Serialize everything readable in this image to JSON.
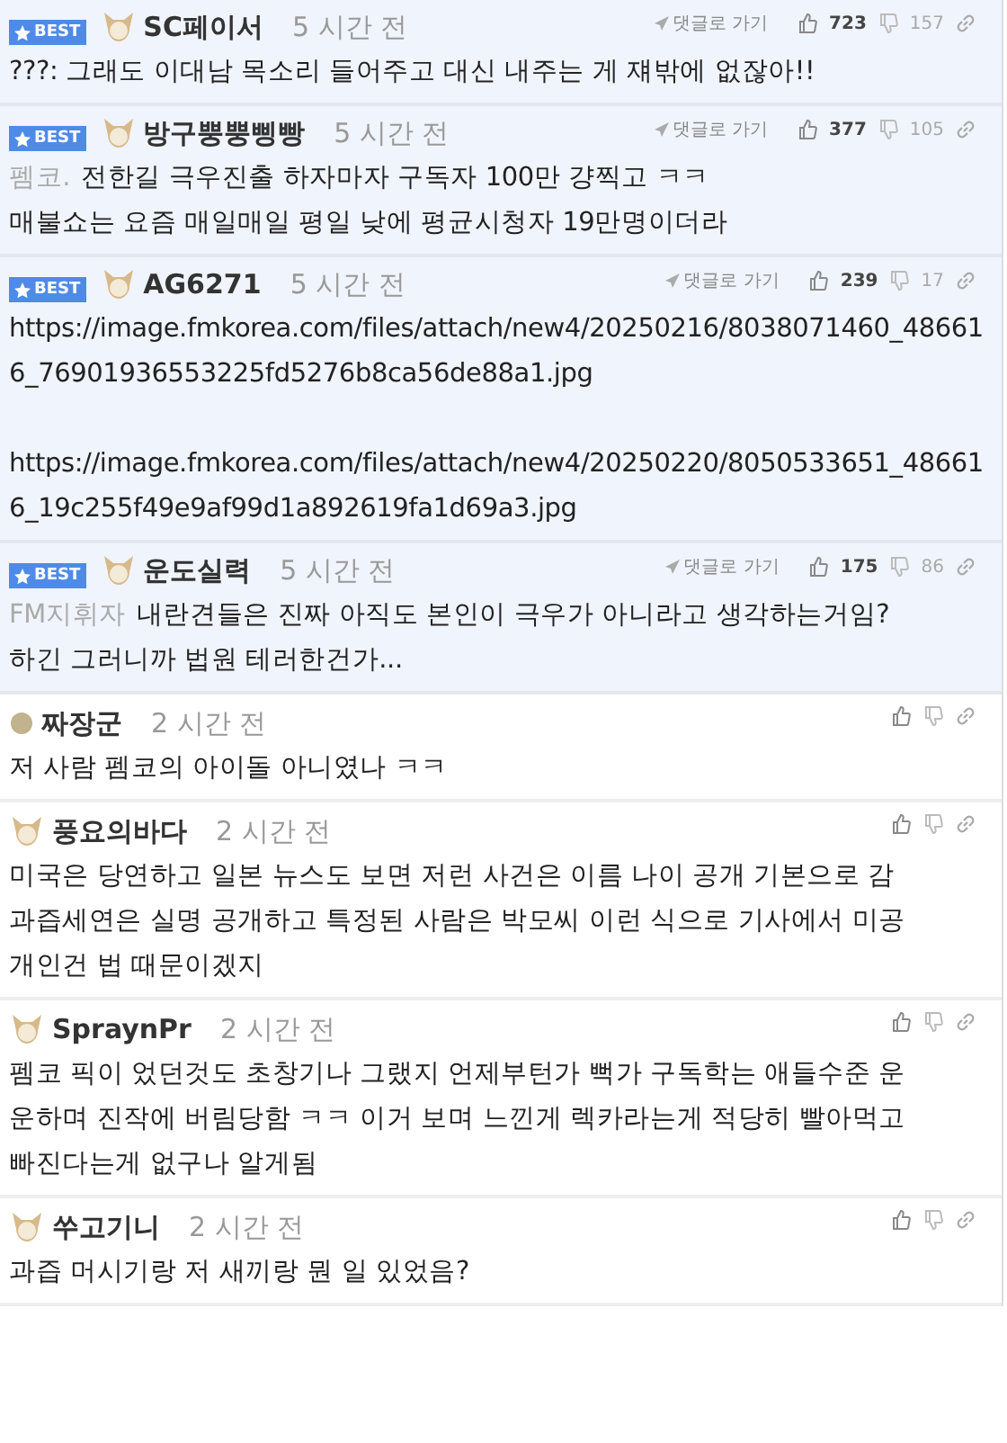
{
  "comments": [
    {
      "best": true,
      "badge": "BEST",
      "avatar": {
        "kind": "animal"
      },
      "nickname": "SC페이서",
      "time": "5 시간 전",
      "reply_link": "댓글로 가기",
      "up": "723",
      "down": "157",
      "paragraphs": [
        [
          "???: 그래도 이대남 목소리 들어주고 대신 내주는 게 쟤밖에 없잖아!!"
        ]
      ]
    },
    {
      "best": true,
      "badge": "BEST",
      "avatar": {
        "kind": "animal"
      },
      "nickname": "방구뿡뿡삥빵",
      "time": "5 시간 전",
      "reply_link": "댓글로 가기",
      "up": "377",
      "down": "105",
      "reply_to": "펨코.",
      "paragraphs": [
        [
          "전한길 극우진출 하자마자 구독자 100만 걍찍고 ㅋㅋ",
          "매불쇼는 요즘 매일매일 평일 낮에 평균시청자 19만명이더라"
        ]
      ]
    },
    {
      "best": true,
      "badge": "BEST",
      "avatar": {
        "kind": "animal"
      },
      "nickname": "AG6271",
      "time": "5 시간 전",
      "reply_link": "댓글로 가기",
      "up": "239",
      "down": "17",
      "paragraphs": [
        [
          "https://image.fmkorea.com/files/attach/new4/20250216/8038071460_48661",
          "6_76901936553225fd5276b8ca56de88a1.jpg"
        ],
        [
          "https://image.fmkorea.com/files/attach/new4/20250220/8050533651_48661",
          "6_19c255f49e9af99d1a892619fa1d69a3.jpg"
        ]
      ]
    },
    {
      "best": true,
      "badge": "BEST",
      "avatar": {
        "kind": "animal"
      },
      "nickname": "운도실력",
      "time": "5 시간 전",
      "reply_link": "댓글로 가기",
      "up": "175",
      "down": "86",
      "reply_to": "FM지휘자",
      "paragraphs": [
        [
          "내란견들은 진짜 아직도 본인이 극우가 아니라고 생각하는거임?",
          "하긴 그러니까 법원 테러한건가..."
        ]
      ]
    },
    {
      "best": false,
      "avatar": {
        "kind": "dot"
      },
      "nickname": "짜장군",
      "time": "2 시간 전",
      "paragraphs": [
        [
          "저 사람 펨코의 아이돌 아니였나 ㅋㅋ"
        ]
      ]
    },
    {
      "best": false,
      "avatar": {
        "kind": "animal"
      },
      "nickname": "풍요의바다",
      "time": "2 시간 전",
      "paragraphs": [
        [
          "미국은 당연하고 일본 뉴스도 보면 저런 사건은 이름 나이 공개 기본으로 감",
          "과즙세연은 실명 공개하고 특정된 사람은 박모씨 이런 식으로 기사에서 미공",
          "개인건 법 때문이겠지"
        ]
      ]
    },
    {
      "best": false,
      "avatar": {
        "kind": "animal"
      },
      "nickname": "SpraynPr",
      "time": "2 시간 전",
      "paragraphs": [
        [
          "펨코 픽이 었던것도 초창기나 그랬지 언제부턴가 뻑가 구독학는 애들수준 운",
          "운하며 진작에 버림당함 ㅋㅋ 이거 보며 느낀게 렉카라는게 적당히 빨아먹고",
          "빠진다는게 없구나 알게됨"
        ]
      ]
    },
    {
      "best": false,
      "avatar": {
        "kind": "animal"
      },
      "nickname": "쑤고기니",
      "time": "2 시간 전",
      "paragraphs": [
        [
          "과즙 머시기랑 저 새끼랑 뭔 일 있었음?"
        ]
      ]
    }
  ]
}
